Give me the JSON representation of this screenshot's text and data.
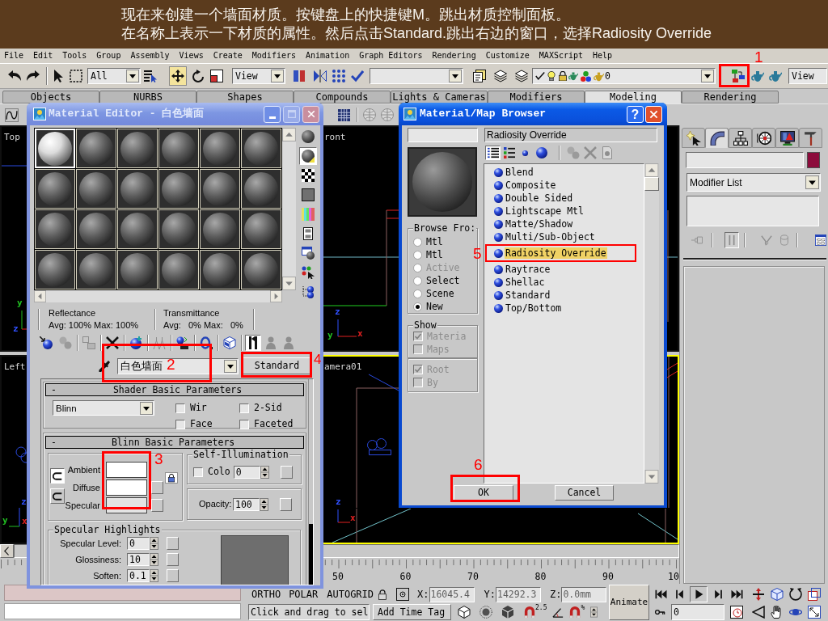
{
  "banner": {
    "lines": [
      "现在来创建一个墙面材质。按键盘上的快捷键M。跳出材质控制面板。",
      "在名称上表示一下材质的属性。然后点击Standard.跳出右边的窗口，选择Radiosity Override"
    ]
  },
  "menu_bar": [
    "File",
    "Edit",
    "Tools",
    "Group",
    "Assembly",
    "Views",
    "Create",
    "Modifiers",
    "Animation",
    "Graph Editors",
    "Rendering",
    "Customize",
    "MAXScript",
    "Help"
  ],
  "main_toolbar": {
    "selection_filter": "All",
    "transform_tools": [
      {
        "kind": "move",
        "selected": true
      },
      {
        "kind": "rotate",
        "selected": false
      },
      {
        "kind": "scale",
        "selected": false
      }
    ],
    "reference_coordinate": "View",
    "layer": "0",
    "viewport_dropdown": "View"
  },
  "tab_panel": [
    {
      "label": "Objects",
      "selected": false
    },
    {
      "label": "NURBS",
      "selected": false
    },
    {
      "label": "Shapes",
      "selected": false
    },
    {
      "label": "Compounds",
      "selected": false
    },
    {
      "label": "Lights & Cameras",
      "selected": false
    },
    {
      "label": "Modifiers",
      "selected": false
    },
    {
      "label": "Modeling",
      "selected": true
    },
    {
      "label": "Rendering",
      "selected": false
    }
  ],
  "viewports": [
    {
      "label": "Top",
      "active": false,
      "axes": [
        {
          "label": "y",
          "color": "#22c022"
        },
        {
          "label": "z",
          "color": "#3050ff"
        }
      ]
    },
    {
      "label": "ront",
      "active": false,
      "axes": [
        {
          "label": "z",
          "color": "#3050ff"
        },
        {
          "label": "y",
          "color": "#22c022"
        },
        {
          "label": "x",
          "color": "#e02020"
        }
      ]
    },
    {
      "label": "Left",
      "active": false,
      "axes": [
        {
          "label": "z",
          "color": "#3050ff"
        },
        {
          "label": "y",
          "color": "#22c022"
        },
        {
          "label": "x",
          "color": "#e02020"
        }
      ]
    },
    {
      "label": "amera01",
      "active": true,
      "axes": [
        {
          "label": "z",
          "color": "#3050ff"
        },
        {
          "label": "x",
          "color": "#e02020"
        }
      ]
    }
  ],
  "timeline": {
    "frame_labels": [
      "50",
      "60",
      "70",
      "80",
      "90",
      "10"
    ]
  },
  "command_panel": {
    "tabs": [
      {
        "kind": "create",
        "selected": false
      },
      {
        "kind": "modify",
        "selected": true
      },
      {
        "kind": "hierarchy",
        "selected": false
      },
      {
        "kind": "motion",
        "selected": false
      },
      {
        "kind": "display",
        "selected": false
      },
      {
        "kind": "utilities",
        "selected": false
      }
    ],
    "object_color": {
      "color": "#8c0c3c"
    },
    "modifier_list": "Modifier List",
    "stack_tools": [
      {
        "kind": "pin",
        "on": false,
        "disabled": true
      },
      {
        "kind": "show_end_result",
        "on": true,
        "disabled": true
      },
      {
        "kind": "make_unique",
        "on": false,
        "disabled": true
      },
      {
        "kind": "remove_modifier",
        "on": false,
        "disabled": true
      },
      {
        "kind": "configure",
        "on": false,
        "disabled": false
      }
    ]
  },
  "status_bar": {
    "drawing_aids": [
      "ORTHO",
      "POLAR",
      "AUTOGRID"
    ],
    "coordinates": [
      {
        "axis": "X:",
        "value": "16045.4"
      },
      {
        "axis": "Y:",
        "value": "14292.3"
      },
      {
        "axis": "Z:",
        "value": "0.0mm"
      }
    ],
    "prompt": "Click and drag to sel",
    "time_tag": "Add Time Tag",
    "snaps": [
      {
        "kind": "snap",
        "label": "2.5"
      },
      {
        "kind": "angle"
      },
      {
        "kind": "percent",
        "label": "%"
      },
      {
        "kind": "spinner"
      }
    ],
    "animate": "Animate",
    "current_frame": "0"
  },
  "material_editor": {
    "title": "Material Editor - 白色墙面",
    "sample_slots": [
      {
        "selected": true
      },
      {
        "selected": false
      },
      {
        "selected": false
      },
      {
        "selected": false
      },
      {
        "selected": false
      },
      {
        "selected": false
      },
      {
        "selected": false
      },
      {
        "selected": false
      },
      {
        "selected": false
      },
      {
        "selected": false
      },
      {
        "selected": false
      },
      {
        "selected": false
      },
      {
        "selected": false
      },
      {
        "selected": false
      },
      {
        "selected": false
      },
      {
        "selected": false
      },
      {
        "selected": false
      },
      {
        "selected": false
      },
      {
        "selected": false
      },
      {
        "selected": false
      },
      {
        "selected": false
      },
      {
        "selected": false
      },
      {
        "selected": false
      },
      {
        "selected": false
      }
    ],
    "side_tools": [
      {
        "kind": "sample_type",
        "on": false
      },
      {
        "kind": "backlight",
        "on": true
      },
      {
        "kind": "background",
        "on": false
      },
      {
        "kind": "tiling",
        "on": false
      },
      {
        "kind": "video_check",
        "on": false
      },
      {
        "kind": "make_preview",
        "on": false
      },
      {
        "kind": "options",
        "on": false
      },
      {
        "kind": "select_by_material",
        "on": false
      },
      {
        "kind": "navigator",
        "on": false
      }
    ],
    "reflectance": {
      "label": "Reflectance",
      "values": "Avg: 100% Max: 100%"
    },
    "transmittance": {
      "label": "Transmittance",
      "values": "Avg:   0% Max:   0%"
    },
    "tools": [
      {
        "kind": "get_material",
        "on": false,
        "disabled": false
      },
      {
        "kind": "put_to_scene",
        "on": false,
        "disabled": true
      },
      {
        "kind": "assign",
        "on": false,
        "disabled": true
      },
      {
        "kind": "reset",
        "on": false,
        "disabled": false
      },
      {
        "kind": "make_copy",
        "on": false,
        "disabled": false
      },
      {
        "kind": "make_unique",
        "on": false,
        "disabled": true
      },
      {
        "kind": "put_to_library",
        "on": false,
        "disabled": false
      },
      {
        "kind": "effects_channel",
        "on": false,
        "disabled": false
      },
      {
        "kind": "show_map",
        "on": false,
        "disabled": false
      },
      {
        "kind": "show_end_result",
        "on": true,
        "disabled": false
      },
      {
        "kind": "go_parent",
        "on": false,
        "disabled": true
      },
      {
        "kind": "go_sibling",
        "on": false,
        "disabled": true
      }
    ],
    "material_name": "白色墙面",
    "material_type": "Standard",
    "shader_rollout": {
      "sign": "-",
      "title": "Shader Basic Parameters",
      "shader": "Blinn",
      "options": [
        {
          "label": "Wir",
          "checked": false
        },
        {
          "label": "2-Sid",
          "checked": false
        },
        {
          "label": "Face",
          "checked": false
        },
        {
          "label": "Faceted",
          "checked": false
        }
      ]
    },
    "basic_rollout": {
      "sign": "-",
      "title": "Blinn Basic Parameters",
      "color_locks": [
        {
          "on": true
        },
        {
          "on": false
        }
      ],
      "colors": [
        {
          "label": "Ambient",
          "color": "#ffffff"
        },
        {
          "label": "Diffuse",
          "color": "#ffffff"
        },
        {
          "label": "Specular",
          "color": "#e4e4e4"
        }
      ],
      "self_illumination": {
        "title": "Self-Illumination",
        "label": "Colo",
        "checked": false,
        "value": "0"
      },
      "opacity": {
        "label": "Opacity:",
        "value": "100"
      },
      "specular_highlights": {
        "title": "Specular Highlights",
        "fields": [
          {
            "label": "Specular Level:",
            "value": "0"
          },
          {
            "label": "Glossiness:",
            "value": "10"
          },
          {
            "label": "Soften:",
            "value": "0.1"
          }
        ]
      }
    }
  },
  "material_browser": {
    "title": "Material/Map Browser",
    "help_button": "?",
    "name_display": "Radiosity Override",
    "view_buttons": [
      {
        "kind": "list",
        "selected": true
      },
      {
        "kind": "list_icons",
        "selected": false
      },
      {
        "kind": "small_icons",
        "selected": false
      },
      {
        "kind": "large_icons",
        "selected": false
      }
    ],
    "library_tools": [
      {
        "kind": "update_scene",
        "disabled": true
      },
      {
        "kind": "delete",
        "disabled": true
      },
      {
        "kind": "clear",
        "disabled": true
      }
    ],
    "browse_from": {
      "title": "Browse Fro:",
      "options": [
        {
          "label": "Mtl",
          "selected": false,
          "disabled": false
        },
        {
          "label": "Mtl",
          "selected": false,
          "disabled": false
        },
        {
          "label": "Active",
          "selected": false,
          "disabled": true
        },
        {
          "label": "Select",
          "selected": false,
          "disabled": false
        },
        {
          "label": "Scene",
          "selected": false,
          "disabled": false
        },
        {
          "label": "New",
          "selected": true,
          "disabled": false
        }
      ]
    },
    "show": {
      "title": "Show",
      "options": [
        {
          "label": "Materia",
          "checked": true,
          "disabled": true
        },
        {
          "label": "Maps",
          "checked": false,
          "disabled": true
        }
      ]
    },
    "show_more": [
      {
        "label": "Root",
        "checked": true,
        "disabled": true
      },
      {
        "label": "By",
        "checked": false,
        "disabled": true
      }
    ],
    "items": [
      {
        "label": "Blend",
        "selected": false
      },
      {
        "label": "Composite",
        "selected": false
      },
      {
        "label": "Double Sided",
        "selected": false
      },
      {
        "label": "Lightscape Mtl",
        "selected": false
      },
      {
        "label": "Matte/Shadow",
        "selected": false
      },
      {
        "label": "Multi/Sub-Object",
        "selected": false
      },
      {
        "label": "Radiosity Override",
        "selected": true
      },
      {
        "label": "Raytrace",
        "selected": false
      },
      {
        "label": "Shellac",
        "selected": false
      },
      {
        "label": "Standard",
        "selected": false
      },
      {
        "label": "Top/Bottom",
        "selected": false
      }
    ],
    "buttons": [
      "OK",
      "Cancel"
    ]
  },
  "annotations": [
    {
      "label": "1"
    },
    {
      "label": "2"
    },
    {
      "label": "3"
    },
    {
      "label": "4"
    },
    {
      "label": "5"
    },
    {
      "label": "6"
    }
  ]
}
